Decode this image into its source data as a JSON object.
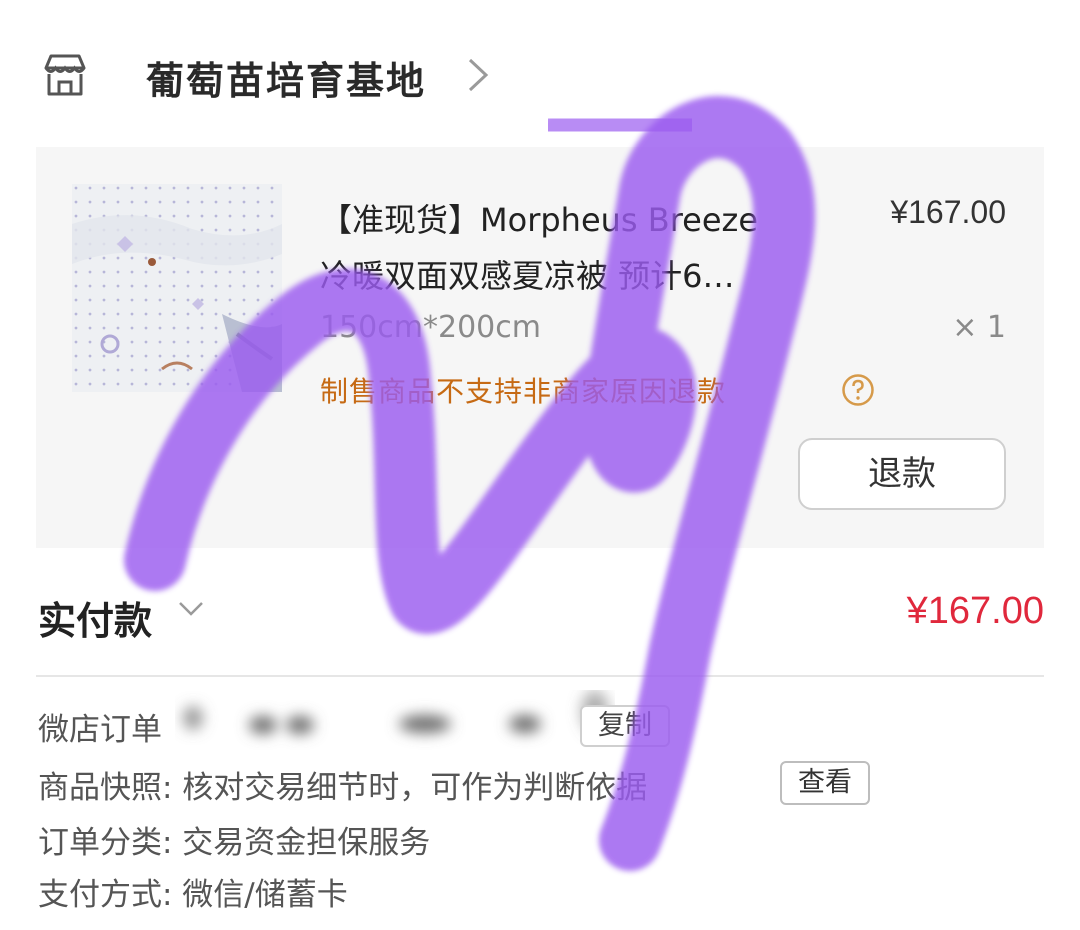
{
  "store": {
    "name": "葡萄苗培育基地",
    "icon": "store-icon",
    "chevron_icon": "chevron-right-icon"
  },
  "product": {
    "title_line1": "【准现货】Morpheus Breeze",
    "title_line2": "冷暖双面双感夏凉被 预计6…",
    "price": "¥167.00",
    "spec": "150cm*200cm",
    "quantity": "× 1",
    "notice": "制售商品不支持非商家原因退款",
    "help_icon": "question-circle-icon",
    "refund_label": "退款"
  },
  "payment": {
    "label": "实付款",
    "chevron_icon": "chevron-down-icon",
    "amount": "¥167.00",
    "accent_color": "#e0283c"
  },
  "order_info": {
    "order_no_label": "微店订单",
    "copy_label": "复制",
    "snapshot_text": "商品快照: 核对交易细节时，可作为判断依据",
    "view_label": "查看",
    "category_text": "订单分类:  交易资金担保服务",
    "payment_method_text": "支付方式:  微信/储蓄卡"
  },
  "overlay": {
    "scribble_color": "#9b5cf0"
  }
}
